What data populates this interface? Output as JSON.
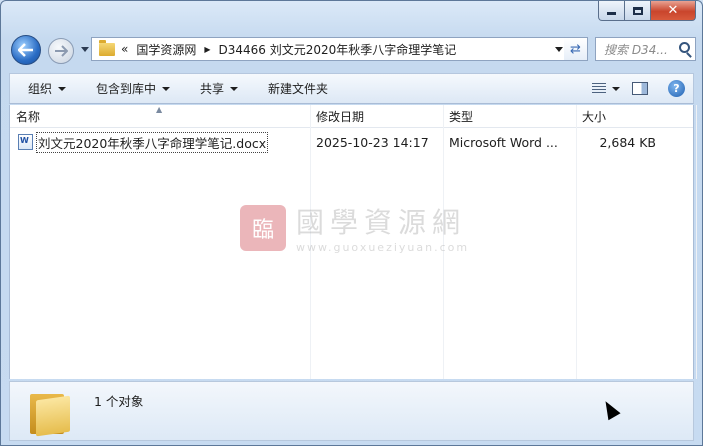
{
  "address": {
    "crumbs": [
      "国学资源网",
      "D34466 刘文元2020年秋季八字命理学笔记"
    ],
    "overflow": "«"
  },
  "search": {
    "placeholder": "搜索 D34..."
  },
  "toolbar": {
    "organize": "组织",
    "include_library": "包含到库中",
    "share": "共享",
    "new_folder": "新建文件夹"
  },
  "columns": {
    "name": "名称",
    "modified": "修改日期",
    "type": "类型",
    "size": "大小"
  },
  "files": [
    {
      "name": "刘文元2020年秋季八字命理学笔记.docx",
      "modified": "2025-10-23 14:17",
      "type": "Microsoft Word ...",
      "size": "2,684 KB"
    }
  ],
  "watermark": {
    "seal": "臨",
    "text": "國學資源網",
    "url": "www.guoxueziyuan.com"
  },
  "status": {
    "count": "1 个对象"
  },
  "window_buttons": {
    "close": "✕"
  },
  "colors": {
    "close_red": "#c9452c",
    "accent_blue": "#2a6cc4"
  }
}
